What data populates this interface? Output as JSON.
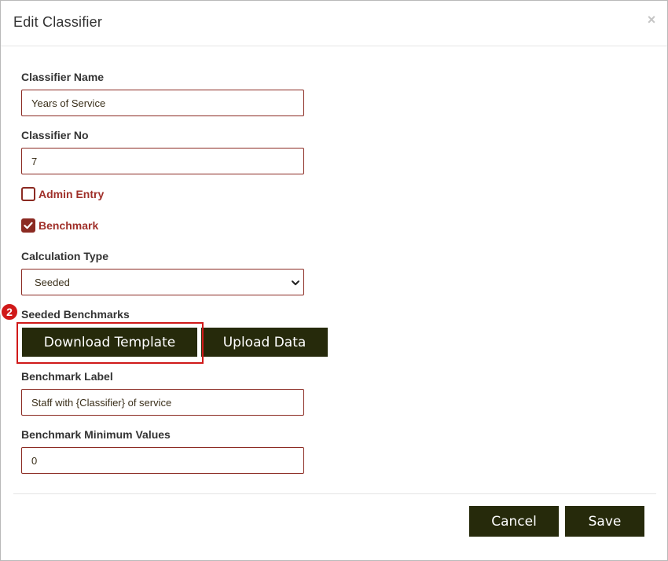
{
  "dialog": {
    "title": "Edit Classifier",
    "close_symbol": "×"
  },
  "form": {
    "classifier_name": {
      "label": "Classifier Name",
      "value": "Years of Service"
    },
    "classifier_no": {
      "label": "Classifier No",
      "value": "7"
    },
    "admin_entry": {
      "label": "Admin Entry",
      "checked": false
    },
    "benchmark": {
      "label": "Benchmark",
      "checked": true
    },
    "calculation_type": {
      "label": "Calculation Type",
      "value": "Seeded",
      "icon": "chevron-down-icon"
    },
    "seeded_benchmarks": {
      "label": "Seeded Benchmarks",
      "download_label": "Download Template",
      "upload_label": "Upload Data"
    },
    "benchmark_label": {
      "label": "Benchmark Label",
      "value": "Staff with {Classifier} of service"
    },
    "benchmark_min": {
      "label": "Benchmark Minimum Values",
      "value": "0"
    }
  },
  "annotation": {
    "step_number": "2",
    "color": "#d01919"
  },
  "footer": {
    "cancel_label": "Cancel",
    "save_label": "Save"
  },
  "colors": {
    "accent": "#8b2a22",
    "button_bg": "#262a0b",
    "check_label": "#a0302a"
  }
}
